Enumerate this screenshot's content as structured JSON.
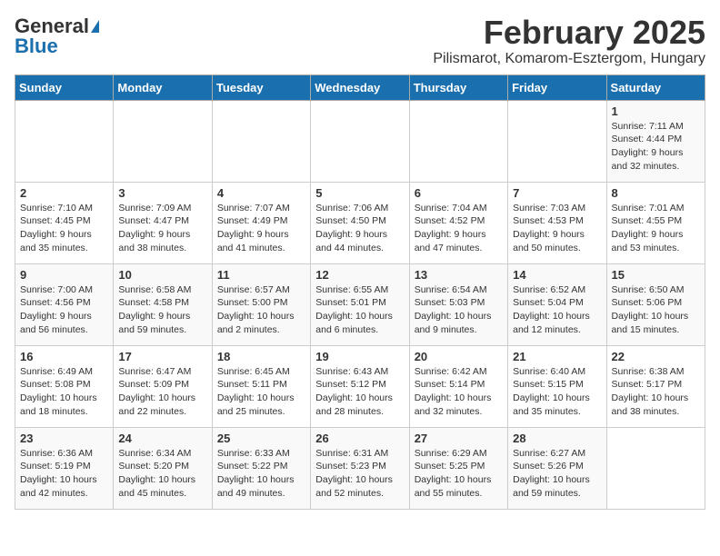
{
  "logo": {
    "line1": "General",
    "line2": "Blue"
  },
  "title": "February 2025",
  "subtitle": "Pilismarot, Komarom-Esztergom, Hungary",
  "weekdays": [
    "Sunday",
    "Monday",
    "Tuesday",
    "Wednesday",
    "Thursday",
    "Friday",
    "Saturday"
  ],
  "weeks": [
    [
      {
        "day": "",
        "info": ""
      },
      {
        "day": "",
        "info": ""
      },
      {
        "day": "",
        "info": ""
      },
      {
        "day": "",
        "info": ""
      },
      {
        "day": "",
        "info": ""
      },
      {
        "day": "",
        "info": ""
      },
      {
        "day": "1",
        "info": "Sunrise: 7:11 AM\nSunset: 4:44 PM\nDaylight: 9 hours and 32 minutes."
      }
    ],
    [
      {
        "day": "2",
        "info": "Sunrise: 7:10 AM\nSunset: 4:45 PM\nDaylight: 9 hours and 35 minutes."
      },
      {
        "day": "3",
        "info": "Sunrise: 7:09 AM\nSunset: 4:47 PM\nDaylight: 9 hours and 38 minutes."
      },
      {
        "day": "4",
        "info": "Sunrise: 7:07 AM\nSunset: 4:49 PM\nDaylight: 9 hours and 41 minutes."
      },
      {
        "day": "5",
        "info": "Sunrise: 7:06 AM\nSunset: 4:50 PM\nDaylight: 9 hours and 44 minutes."
      },
      {
        "day": "6",
        "info": "Sunrise: 7:04 AM\nSunset: 4:52 PM\nDaylight: 9 hours and 47 minutes."
      },
      {
        "day": "7",
        "info": "Sunrise: 7:03 AM\nSunset: 4:53 PM\nDaylight: 9 hours and 50 minutes."
      },
      {
        "day": "8",
        "info": "Sunrise: 7:01 AM\nSunset: 4:55 PM\nDaylight: 9 hours and 53 minutes."
      }
    ],
    [
      {
        "day": "9",
        "info": "Sunrise: 7:00 AM\nSunset: 4:56 PM\nDaylight: 9 hours and 56 minutes."
      },
      {
        "day": "10",
        "info": "Sunrise: 6:58 AM\nSunset: 4:58 PM\nDaylight: 9 hours and 59 minutes."
      },
      {
        "day": "11",
        "info": "Sunrise: 6:57 AM\nSunset: 5:00 PM\nDaylight: 10 hours and 2 minutes."
      },
      {
        "day": "12",
        "info": "Sunrise: 6:55 AM\nSunset: 5:01 PM\nDaylight: 10 hours and 6 minutes."
      },
      {
        "day": "13",
        "info": "Sunrise: 6:54 AM\nSunset: 5:03 PM\nDaylight: 10 hours and 9 minutes."
      },
      {
        "day": "14",
        "info": "Sunrise: 6:52 AM\nSunset: 5:04 PM\nDaylight: 10 hours and 12 minutes."
      },
      {
        "day": "15",
        "info": "Sunrise: 6:50 AM\nSunset: 5:06 PM\nDaylight: 10 hours and 15 minutes."
      }
    ],
    [
      {
        "day": "16",
        "info": "Sunrise: 6:49 AM\nSunset: 5:08 PM\nDaylight: 10 hours and 18 minutes."
      },
      {
        "day": "17",
        "info": "Sunrise: 6:47 AM\nSunset: 5:09 PM\nDaylight: 10 hours and 22 minutes."
      },
      {
        "day": "18",
        "info": "Sunrise: 6:45 AM\nSunset: 5:11 PM\nDaylight: 10 hours and 25 minutes."
      },
      {
        "day": "19",
        "info": "Sunrise: 6:43 AM\nSunset: 5:12 PM\nDaylight: 10 hours and 28 minutes."
      },
      {
        "day": "20",
        "info": "Sunrise: 6:42 AM\nSunset: 5:14 PM\nDaylight: 10 hours and 32 minutes."
      },
      {
        "day": "21",
        "info": "Sunrise: 6:40 AM\nSunset: 5:15 PM\nDaylight: 10 hours and 35 minutes."
      },
      {
        "day": "22",
        "info": "Sunrise: 6:38 AM\nSunset: 5:17 PM\nDaylight: 10 hours and 38 minutes."
      }
    ],
    [
      {
        "day": "23",
        "info": "Sunrise: 6:36 AM\nSunset: 5:19 PM\nDaylight: 10 hours and 42 minutes."
      },
      {
        "day": "24",
        "info": "Sunrise: 6:34 AM\nSunset: 5:20 PM\nDaylight: 10 hours and 45 minutes."
      },
      {
        "day": "25",
        "info": "Sunrise: 6:33 AM\nSunset: 5:22 PM\nDaylight: 10 hours and 49 minutes."
      },
      {
        "day": "26",
        "info": "Sunrise: 6:31 AM\nSunset: 5:23 PM\nDaylight: 10 hours and 52 minutes."
      },
      {
        "day": "27",
        "info": "Sunrise: 6:29 AM\nSunset: 5:25 PM\nDaylight: 10 hours and 55 minutes."
      },
      {
        "day": "28",
        "info": "Sunrise: 6:27 AM\nSunset: 5:26 PM\nDaylight: 10 hours and 59 minutes."
      },
      {
        "day": "",
        "info": ""
      }
    ]
  ]
}
